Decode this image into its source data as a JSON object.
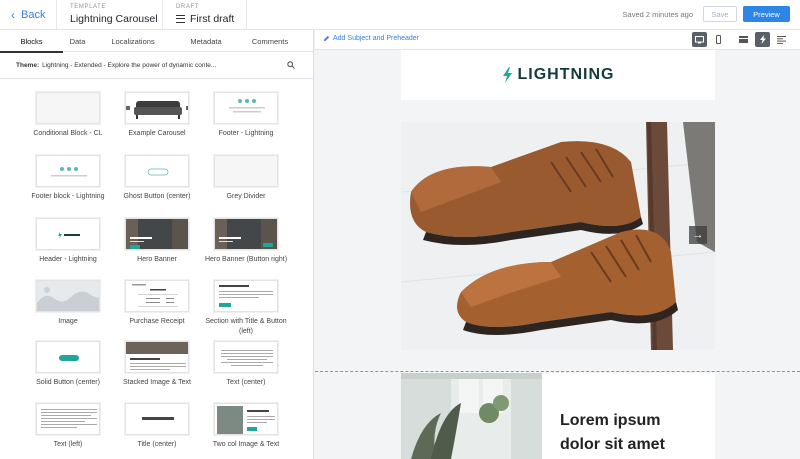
{
  "topbar": {
    "back_label": "Back",
    "template_caption": "TEMPLATE",
    "template_name": "Lightning Carousel",
    "draft_caption": "DRAFT",
    "draft_name": "First draft",
    "saved_text": "Saved 2 minutes ago",
    "save_label": "Save",
    "preview_label": "Preview"
  },
  "left": {
    "tabs": [
      "Blocks",
      "Data",
      "Localizations",
      "Metadata",
      "Comments"
    ],
    "active_tab": "Blocks",
    "theme_label": "Theme:",
    "theme_value": "Lightning - Extended - Explore the power of dynamic conte...",
    "blocks": [
      "Conditional Block - CL",
      "Example Carousel",
      "Footer - Lightning",
      "Footer block - Lightning",
      "Ghost Button (center)",
      "Grey Divider",
      "Header - Lightning",
      "Hero Banner",
      "Hero Banner (Button right)",
      "Image",
      "Purchase Receipt",
      "Section with Title & Button (left)",
      "Solid Button (center)",
      "Stacked Image & Text",
      "Text (center)",
      "Text (left)",
      "Title (center)",
      "Two col Image & Text"
    ]
  },
  "canvas": {
    "add_subject": "Add Subject and Preheader",
    "logo_text": "LIGHTNING",
    "headline": "Lorem ipsum dolor sit amet"
  },
  "colors": {
    "accent": "#2d86e6",
    "link": "#3a7fd9",
    "brand": "#1fa79a"
  }
}
